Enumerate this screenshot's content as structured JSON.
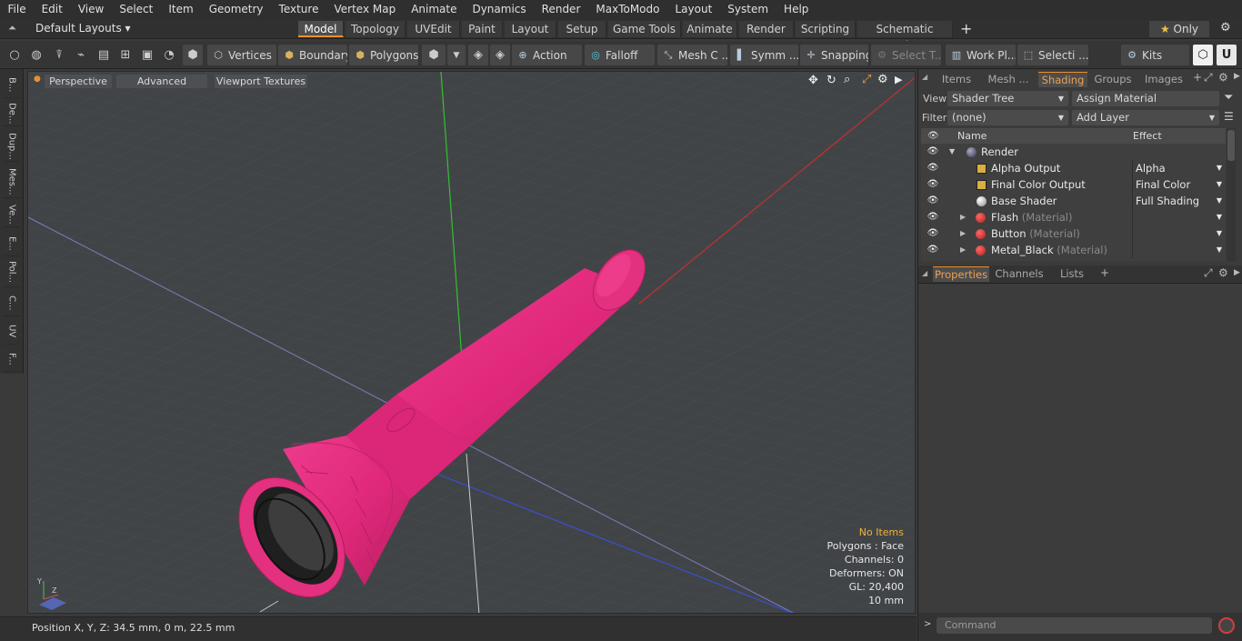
{
  "menu": [
    "File",
    "Edit",
    "View",
    "Select",
    "Item",
    "Geometry",
    "Texture",
    "Vertex Map",
    "Animate",
    "Dynamics",
    "Render",
    "MaxToModo",
    "Layout",
    "System",
    "Help"
  ],
  "layouts": {
    "label": "Default Layouts"
  },
  "layout_tabs": [
    "Model",
    "Topology",
    "UVEdit",
    "Paint",
    "Layout",
    "Setup",
    "Game Tools",
    "Animate",
    "Render",
    "Scripting",
    "Schematic Fusion"
  ],
  "only_label": "Only",
  "toolbar": {
    "vertices": "Vertices",
    "boundary": "Boundary",
    "polygons": "Polygons",
    "action": "Action",
    "falloff": "Falloff",
    "meshc": "Mesh C ...",
    "symm": "Symm ...",
    "snapping": "Snapping",
    "selectt": "Select T...",
    "workpl": "Work Pl...",
    "selecti": "Selecti ...",
    "kits": "Kits"
  },
  "left_tabs": [
    "B...",
    "De...",
    "Dup...",
    "Mes...",
    "Ve...",
    "E...",
    "Pol...",
    "C...",
    "UV",
    "F..."
  ],
  "viewport": {
    "perspective": "Perspective",
    "advanced": "Advanced",
    "textures": "Viewport Textures",
    "hud": {
      "no_items": "No Items",
      "polygons": "Polygons : Face",
      "channels": "Channels: 0",
      "deformers": "Deformers: ON",
      "gl": "GL: 20,400",
      "scale": "10 mm"
    }
  },
  "status": {
    "position": "Position X, Y, Z:   34.5 mm, 0 m, 22.5 mm"
  },
  "panel_tabs": [
    "Items",
    "Mesh ...",
    "Shading",
    "Groups",
    "Images"
  ],
  "shading": {
    "view_label": "View",
    "view_value": "Shader Tree",
    "assign": "Assign Material",
    "filter_label": "Filter",
    "filter_value": "(none)",
    "add_layer": "Add Layer",
    "col_name": "Name",
    "col_effect": "Effect",
    "rows": [
      {
        "name": "Render",
        "sub": "",
        "effect": ""
      },
      {
        "name": "Alpha Output",
        "sub": "",
        "effect": "Alpha"
      },
      {
        "name": "Final Color Output",
        "sub": "",
        "effect": "Final Color"
      },
      {
        "name": "Base Shader",
        "sub": "",
        "effect": "Full Shading"
      },
      {
        "name": "Flash",
        "sub": "(Material)",
        "effect": ""
      },
      {
        "name": "Button",
        "sub": "(Material)",
        "effect": ""
      },
      {
        "name": "Metal_Black",
        "sub": "(Material)",
        "effect": ""
      }
    ]
  },
  "props_tabs": [
    "Properties",
    "Channels",
    "Lists"
  ],
  "command": {
    "placeholder": "Command"
  },
  "colors": {
    "accent": "#e8902c",
    "model": "#e0287a"
  }
}
